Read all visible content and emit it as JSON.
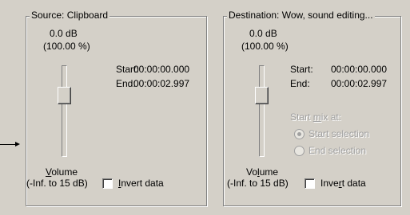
{
  "source": {
    "title": "Source: Clipboard",
    "level_db": "0.0 dB",
    "level_pct": "(100.00 %)",
    "start_label": "Start:",
    "start_value": "00:00:00.000",
    "end_label": "End:",
    "end_value": "00:00:02.997",
    "volume_label_u": "V",
    "volume_label_rest": "olume",
    "range_label": "(-Inf. to 15 dB)",
    "invert_u": "I",
    "invert_rest": "nvert data"
  },
  "destination": {
    "title": "Destination: Wow, sound editing...",
    "level_db": "0.0 dB",
    "level_pct": "(100.00 %)",
    "start_label": "Start:",
    "start_value": "00:00:00.000",
    "end_label": "End:",
    "end_value": "00:00:02.997",
    "volume_label_a": "Vo",
    "volume_label_u": "l",
    "volume_label_b": "ume",
    "range_label": "(-Inf. to 15 dB)",
    "invert_a": "Inve",
    "invert_u": "r",
    "invert_b": "t data",
    "start_mix_a": "Start ",
    "start_mix_u": "m",
    "start_mix_b": "ix at:",
    "opt_start_selection": "Start selection",
    "opt_end_selection": "End selection"
  },
  "controls": {
    "src_invert_checked": false,
    "dst_invert_checked": false,
    "start_mix_selected": "start-selection"
  }
}
